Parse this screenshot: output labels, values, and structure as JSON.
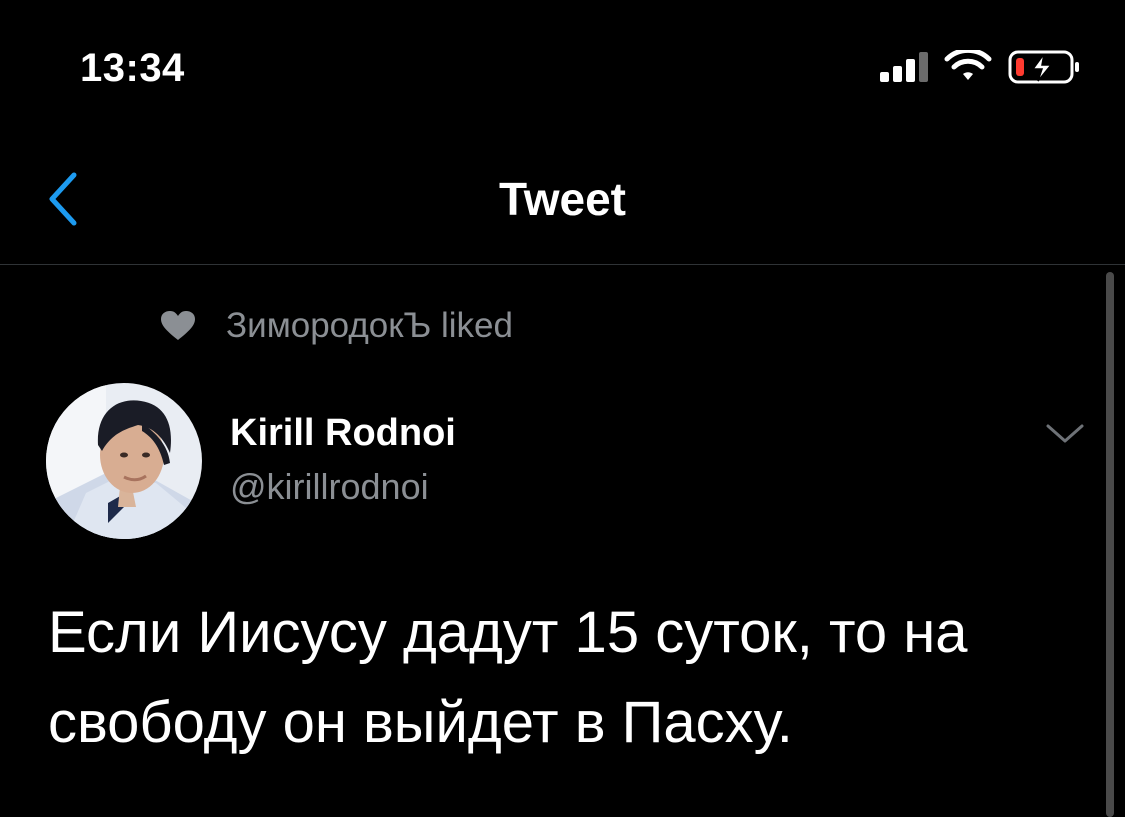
{
  "status_bar": {
    "time": "13:34",
    "icons": [
      "cellular-signal-icon",
      "wifi-icon",
      "battery-low-charging-icon"
    ]
  },
  "nav": {
    "title": "Tweet",
    "back_icon": "chevron-left-icon"
  },
  "tweet": {
    "social_context": {
      "icon": "heart-icon",
      "text": "ЗимородокЪ liked"
    },
    "author": {
      "name": "Kirill Rodnoi",
      "handle": "@kirillrodnoi",
      "avatar": "avatar-photo"
    },
    "menu_icon": "chevron-down-icon",
    "text": "Если Иисусу дадут 15 суток, то на свободу он выйдет в Пасху."
  },
  "colors": {
    "background": "#000000",
    "text_primary": "#ffffff",
    "text_secondary": "#8b8f94",
    "accent": "#1d9bf0",
    "battery_low": "#ff3b30",
    "divider": "#2f3336"
  }
}
